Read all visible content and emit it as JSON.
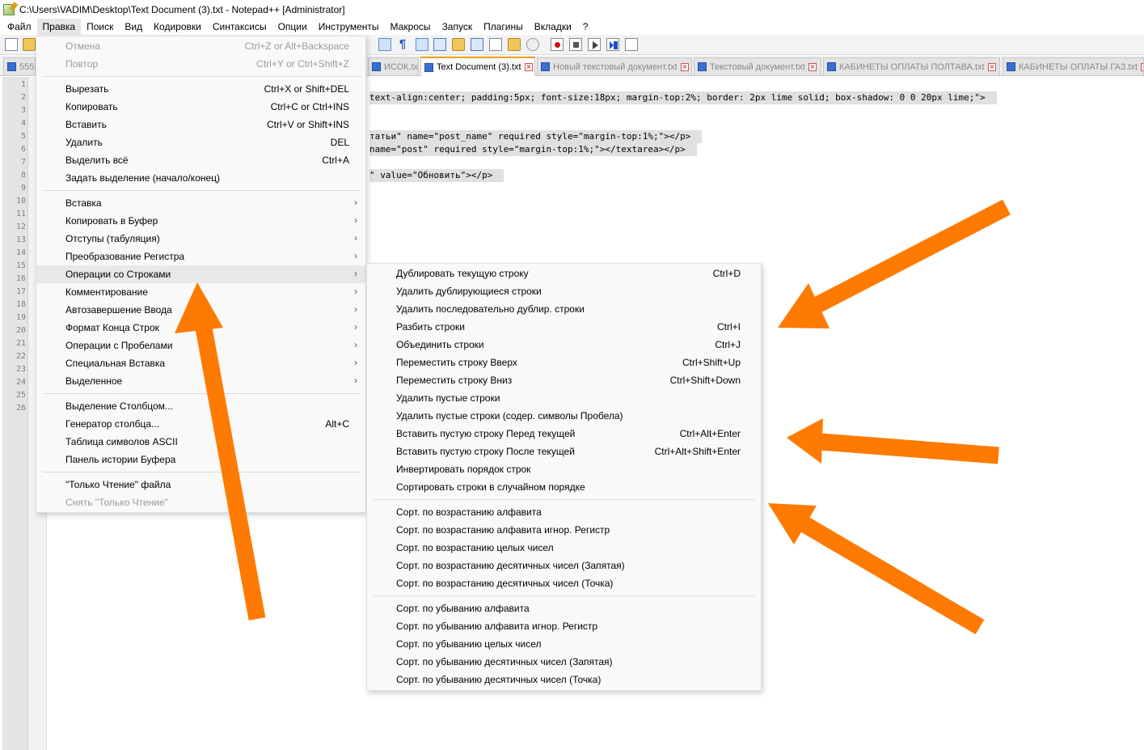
{
  "window": {
    "title": "C:\\Users\\VADIM\\Desktop\\Text Document (3).txt - Notepad++ [Administrator]"
  },
  "menubar": {
    "items": [
      "Файл",
      "Правка",
      "Поиск",
      "Вид",
      "Кодировки",
      "Синтаксисы",
      "Опции",
      "Инструменты",
      "Макросы",
      "Запуск",
      "Плагины",
      "Вкладки",
      "?"
    ],
    "active_index": 1
  },
  "toolbar": {
    "icons": [
      "new-file-icon",
      "open-folder-icon",
      "wrap-icon",
      "show-all-chars-icon",
      "indent-guide-icon",
      "document-map-icon",
      "function-list-icon",
      "folder-workspace-icon",
      "monitoring-icon",
      "record-macro-icon",
      "stop-record-icon",
      "play-macro-icon",
      "run-macro-multiple-icon",
      "save-macro-icon"
    ]
  },
  "tabs": [
    {
      "label": "5559",
      "active": false
    },
    {
      "label": "ИСОК.txt",
      "active": false
    },
    {
      "label": "Text Document (3).txt",
      "active": true
    },
    {
      "label": "Новый текстовый документ.txt",
      "active": false
    },
    {
      "label": "Текстовый документ.txt",
      "active": false
    },
    {
      "label": "КАБИНЕТЫ ОПЛАТЫ ПОЛТАВА.txt",
      "active": false
    },
    {
      "label": "КАБИНЕТЫ ОПЛАТЫ ГАЗ.txt",
      "active": false
    }
  ],
  "editor": {
    "line_numbers": [
      "1",
      "2",
      "3",
      "4",
      "5",
      "6",
      "7",
      "8",
      "9",
      "10",
      "11",
      "12",
      "13",
      "14",
      "15",
      "16",
      "17",
      "18",
      "19",
      "20",
      "21",
      "22",
      "23",
      "24",
      "25",
      "26"
    ],
    "visible_code": [
      {
        "line": 2,
        "text": "text-align:center; padding:5px; font-size:18px; margin-top:2%; border: 2px lime solid; box-shadow: 0 0 20px lime;\">"
      },
      {
        "line": 5,
        "text": "татьи\" name=\"post_name\" required style=\"margin-top:1%;\"></p>"
      },
      {
        "line": 6,
        "text": "name=\"post\" required style=\"margin-top:1%;\"></textarea></p>"
      },
      {
        "line": 8,
        "text": "\" value=\"Обновить\"></p>"
      }
    ]
  },
  "edit_menu": {
    "groups": [
      [
        {
          "label": "Отмена",
          "shortcut": "Ctrl+Z or Alt+Backspace",
          "disabled": true
        },
        {
          "label": "Повтор",
          "shortcut": "Ctrl+Y or Ctrl+Shift+Z",
          "disabled": true
        }
      ],
      [
        {
          "label": "Вырезать",
          "shortcut": "Ctrl+X or Shift+DEL"
        },
        {
          "label": "Копировать",
          "shortcut": "Ctrl+C or Ctrl+INS"
        },
        {
          "label": "Вставить",
          "shortcut": "Ctrl+V or Shift+INS"
        },
        {
          "label": "Удалить",
          "shortcut": "DEL"
        },
        {
          "label": "Выделить всё",
          "shortcut": "Ctrl+A"
        },
        {
          "label": "Задать выделение (начало/конец)",
          "shortcut": ""
        }
      ],
      [
        {
          "label": "Вставка",
          "submenu": true
        },
        {
          "label": "Копировать в Буфер",
          "submenu": true
        },
        {
          "label": "Отступы (табуляция)",
          "submenu": true
        },
        {
          "label": "Преобразование Регистра",
          "submenu": true
        },
        {
          "label": "Операции со Строками",
          "submenu": true,
          "highlighted": true
        },
        {
          "label": "Комментирование",
          "submenu": true
        },
        {
          "label": "Автозавершение Ввода",
          "submenu": true
        },
        {
          "label": "Формат Конца Строк",
          "submenu": true
        },
        {
          "label": "Операции с Пробелами",
          "submenu": true
        },
        {
          "label": "Специальная Вставка",
          "submenu": true
        },
        {
          "label": "Выделенное",
          "submenu": true
        }
      ],
      [
        {
          "label": "Выделение Столбцом...",
          "shortcut": ""
        },
        {
          "label": "Генератор столбца...",
          "shortcut": "Alt+C"
        },
        {
          "label": "Таблица символов ASCII",
          "shortcut": ""
        },
        {
          "label": "Панель истории Буфера",
          "shortcut": ""
        }
      ],
      [
        {
          "label": "\"Только Чтение\" файла",
          "shortcut": ""
        },
        {
          "label": "Снять \"Только Чтение\"",
          "shortcut": "",
          "disabled": true
        }
      ]
    ]
  },
  "line_ops_submenu": {
    "groups": [
      [
        {
          "label": "Дублировать текущую строку",
          "shortcut": "Ctrl+D"
        },
        {
          "label": "Удалить дублирующиеся строки",
          "shortcut": ""
        },
        {
          "label": "Удалить последовательно дублир. строки",
          "shortcut": ""
        },
        {
          "label": "Разбить строки",
          "shortcut": "Ctrl+I"
        },
        {
          "label": "Объединить строки",
          "shortcut": "Ctrl+J"
        },
        {
          "label": "Переместить строку Вверх",
          "shortcut": "Ctrl+Shift+Up"
        },
        {
          "label": "Переместить строку Вниз",
          "shortcut": "Ctrl+Shift+Down"
        },
        {
          "label": "Удалить пустые строки",
          "shortcut": ""
        },
        {
          "label": "Удалить пустые строки  (содер. символы Пробела)",
          "shortcut": ""
        },
        {
          "label": "Вставить пустую строку Перед текущей",
          "shortcut": "Ctrl+Alt+Enter"
        },
        {
          "label": "Вставить пустую строку После текущей",
          "shortcut": "Ctrl+Alt+Shift+Enter"
        },
        {
          "label": "Инвертировать порядок строк",
          "shortcut": ""
        },
        {
          "label": "Сортировать строки в случайном порядке",
          "shortcut": ""
        }
      ],
      [
        {
          "label": "Сорт. по возрастанию алфавита",
          "shortcut": ""
        },
        {
          "label": "Сорт. по возрастанию алфавита игнор. Регистр",
          "shortcut": ""
        },
        {
          "label": "Сорт. по возрастанию целых чисел",
          "shortcut": ""
        },
        {
          "label": "Сорт. по возрастанию десятичных чисел  (Запятая)",
          "shortcut": ""
        },
        {
          "label": "Сорт. по возрастанию десятичных чисел  (Точка)",
          "shortcut": ""
        }
      ],
      [
        {
          "label": "Сорт. по убыванию алфавита",
          "shortcut": ""
        },
        {
          "label": "Сорт. по убыванию алфавита игнор. Регистр",
          "shortcut": ""
        },
        {
          "label": "Сорт. по убыванию целых чисел",
          "shortcut": ""
        },
        {
          "label": "Сорт. по убыванию десятичных чисел  (Запятая)",
          "shortcut": ""
        },
        {
          "label": "Сорт. по убыванию десятичных чисел  (Точка)",
          "shortcut": ""
        }
      ]
    ]
  },
  "annotation": {
    "arrow_color": "#ff7a00"
  }
}
